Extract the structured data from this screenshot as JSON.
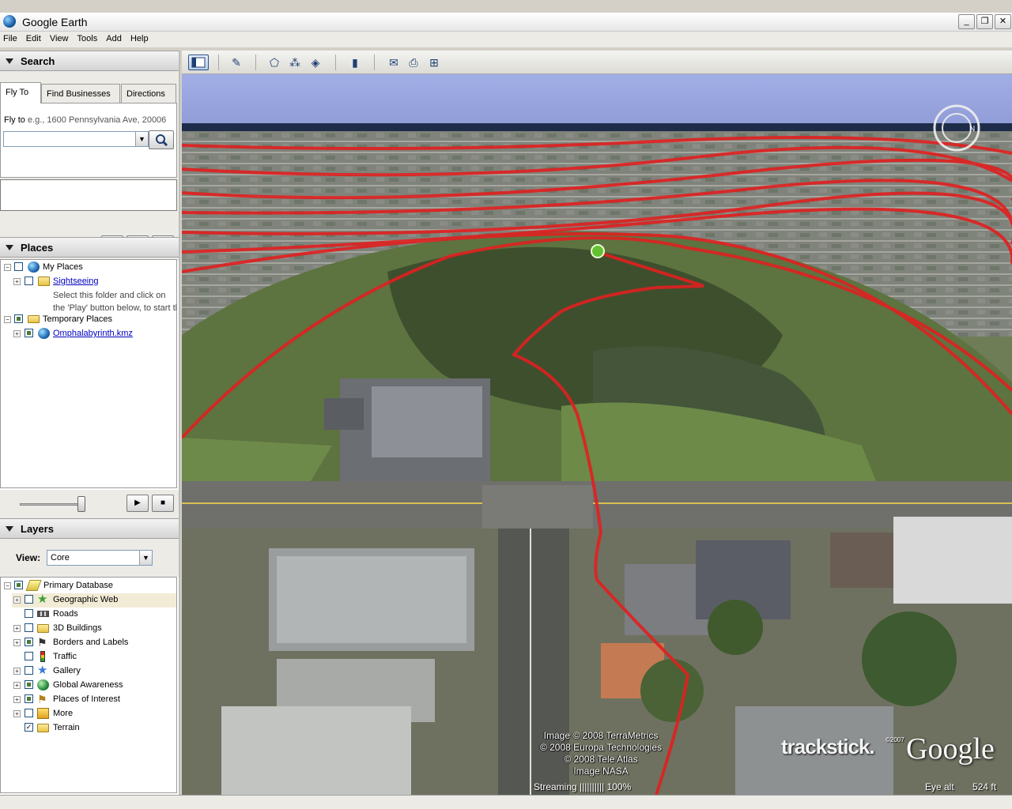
{
  "window": {
    "title": "Google Earth"
  },
  "menu": [
    "File",
    "Edit",
    "View",
    "Tools",
    "Add",
    "Help"
  ],
  "search": {
    "header": "Search",
    "tabs": [
      "Fly To",
      "Find Businesses",
      "Directions"
    ],
    "flyto_label": "Fly to",
    "flyto_example": "e.g., 1600 Pennsylvania Ave, 20006",
    "input_value": ""
  },
  "places": {
    "header": "Places",
    "items": [
      {
        "label": "My Places",
        "checked": "partial"
      },
      {
        "label": "Sightseeing",
        "checked": "none",
        "link": true
      },
      {
        "label": "Temporary Places",
        "checked": "partial"
      },
      {
        "label": "Omphalabyrinth.kmz",
        "checked": "partial",
        "link": true
      }
    ],
    "desc_line1": "Select this folder and click on",
    "desc_line2": "the 'Play' button below, to start th"
  },
  "layers": {
    "header": "Layers",
    "view_label": "View:",
    "view_value": "Core",
    "items": [
      {
        "label": "Primary Database",
        "checked": "partial"
      },
      {
        "label": "Geographic Web",
        "checked": "none"
      },
      {
        "label": "Roads",
        "checked": "none"
      },
      {
        "label": "3D Buildings",
        "checked": "none"
      },
      {
        "label": "Borders and Labels",
        "checked": "partial"
      },
      {
        "label": "Traffic",
        "checked": "none"
      },
      {
        "label": "Gallery",
        "checked": "none"
      },
      {
        "label": "Global Awareness",
        "checked": "partial"
      },
      {
        "label": "Places of Interest",
        "checked": "partial"
      },
      {
        "label": "More",
        "checked": "none"
      },
      {
        "label": "Terrain",
        "checked": "checked"
      }
    ]
  },
  "map": {
    "attribution": [
      "Image © 2008 TerraMetrics",
      "© 2008 Europa Technologies",
      "© 2008 Tele Atlas",
      "Image NASA"
    ],
    "streaming_label": "Streaming",
    "streaming_bar": "||||||||||",
    "streaming_value": "100%",
    "eye_alt_label": "Eye alt",
    "eye_alt_value": "524 ft",
    "trackstick": "trackstick.",
    "copyright_year": "©2007",
    "google": "Google"
  },
  "colors": {
    "track": "#e02020",
    "sky": "#9aa6e0"
  },
  "icons": [
    "search-icon",
    "play-icon",
    "stop-icon",
    "close-icon",
    "globe-icon",
    "folder-icon",
    "compass-icon"
  ]
}
